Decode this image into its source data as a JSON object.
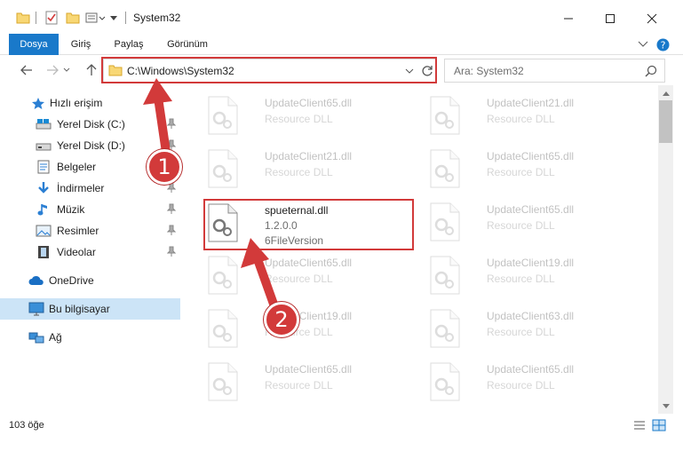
{
  "window": {
    "title": "System32"
  },
  "ribbon": {
    "tabs": [
      {
        "label": "Dosya"
      },
      {
        "label": "Giriş"
      },
      {
        "label": "Paylaş"
      },
      {
        "label": "Görünüm"
      }
    ]
  },
  "address": {
    "path": "C:\\Windows\\System32",
    "search_placeholder": "Ara: System32"
  },
  "navpane": {
    "quick_access": "Hızlı erişim",
    "items": [
      {
        "label": "Yerel Disk (C:)"
      },
      {
        "label": "Yerel Disk (D:)"
      },
      {
        "label": "Belgeler"
      },
      {
        "label": "İndirmeler"
      },
      {
        "label": "Müzik"
      },
      {
        "label": "Resimler"
      },
      {
        "label": "Videolar"
      }
    ],
    "onedrive": "OneDrive",
    "this_pc": "Bu bilgisayar",
    "network": "Ağ"
  },
  "files": {
    "left": [
      {
        "name": "UpdateClient65.dll",
        "desc": "Resource DLL"
      },
      {
        "name": "UpdateClient21.dll",
        "desc": "Resource DLL"
      },
      {
        "name": "spueternal.dll",
        "version": "1.2.0.0",
        "desc": "6FileVersion"
      },
      {
        "name": "UpdateClient65.dll",
        "desc": "Resource DLL"
      },
      {
        "name": "UpdateClient19.dll",
        "desc": "Resource DLL"
      },
      {
        "name": "UpdateClient65.dll",
        "desc": "Resource DLL"
      }
    ],
    "right": [
      {
        "name": "UpdateClient21.dll",
        "desc": "Resource DLL"
      },
      {
        "name": "UpdateClient65.dll",
        "desc": "Resource DLL"
      },
      {
        "name": "UpdateClient65.dll",
        "desc": "Resource DLL"
      },
      {
        "name": "UpdateClient19.dll",
        "desc": "Resource DLL"
      },
      {
        "name": "UpdateClient63.dll",
        "desc": "Resource DLL"
      },
      {
        "name": "UpdateClient65.dll",
        "desc": "Resource DLL"
      }
    ]
  },
  "status": {
    "count": "103 öğe"
  },
  "annotations": {
    "step1": "1",
    "step2": "2",
    "color": "#d23a3a"
  },
  "colors": {
    "accent": "#1979ca",
    "selection": "#cce4f7"
  }
}
